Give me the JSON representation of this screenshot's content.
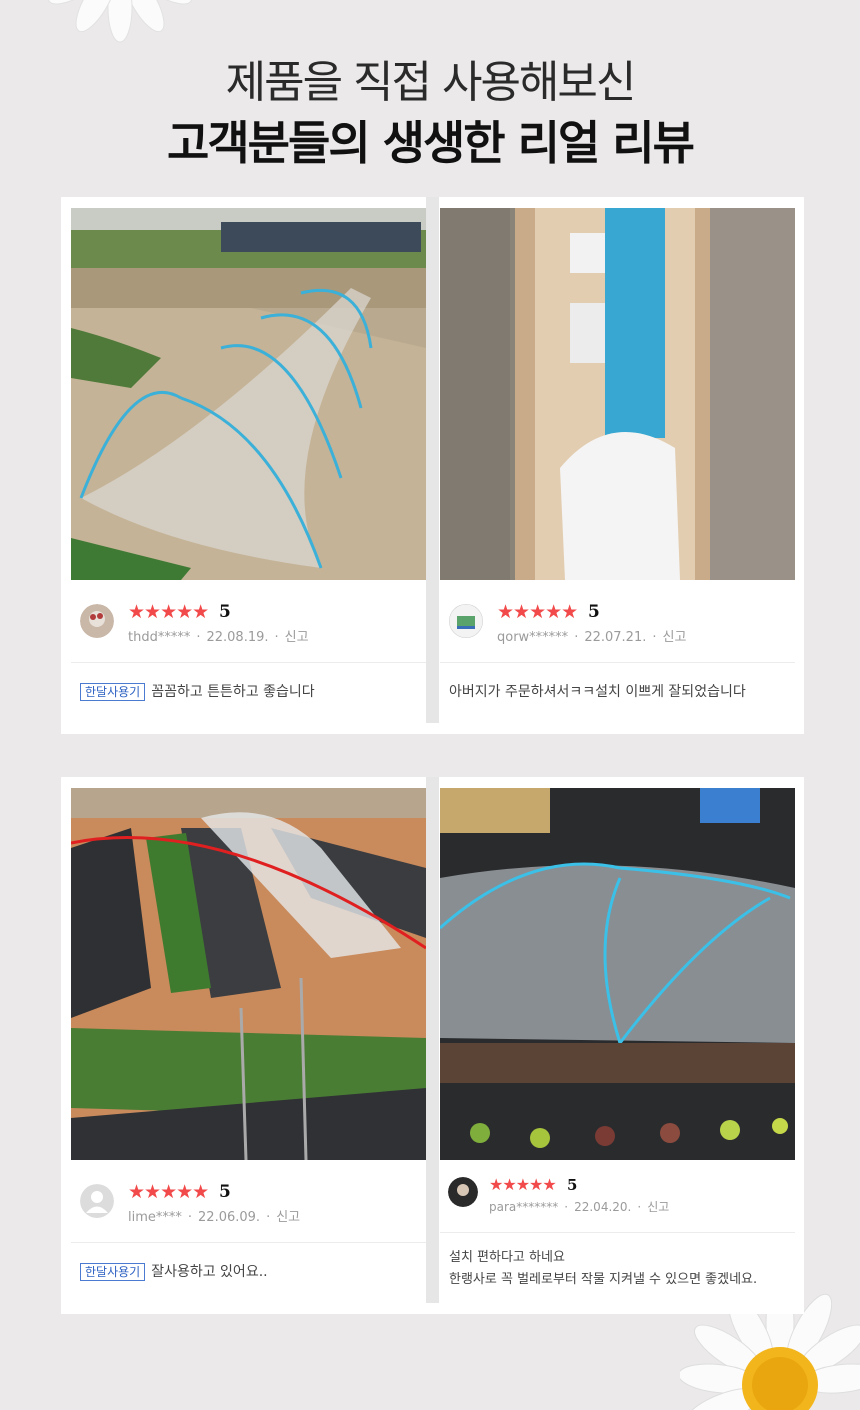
{
  "header": {
    "line1": "제품을 직접 사용해보신",
    "line2": "고객분들의 생생한 리얼 리뷰"
  },
  "review_labels": {
    "tag": "한달사용기",
    "report": "신고",
    "score": "5",
    "stars": "★★★★★"
  },
  "reviews": [
    {
      "user": "thdd*****",
      "date": "22.08.19.",
      "text": "꼼꼼하고 튼튼하고 좋습니다"
    },
    {
      "user": "qorw******",
      "date": "22.07.21.",
      "text": "아버지가 주문하셔서ㅋㅋ설치 이쁘게 잘되었습니다"
    },
    {
      "user": "lime****",
      "date": "22.06.09.",
      "text": "잘사용하고 있어요.."
    },
    {
      "user": "para*******",
      "date": "22.04.20.",
      "text_line1": "설치 편하다고 하네요",
      "text_line2": "한랭사로 꼭 벌레로부터 작물 지켜낼 수 있으면 좋겠네요."
    }
  ],
  "colors": {
    "background": "#ebe9ea",
    "star": "#f24a4a",
    "tag_border": "#4a7bd0",
    "net_pipe": "#3bb0d8"
  },
  "icons": [
    "daisy-flower-icon",
    "star-rating-icon",
    "user-avatar-icon"
  ]
}
